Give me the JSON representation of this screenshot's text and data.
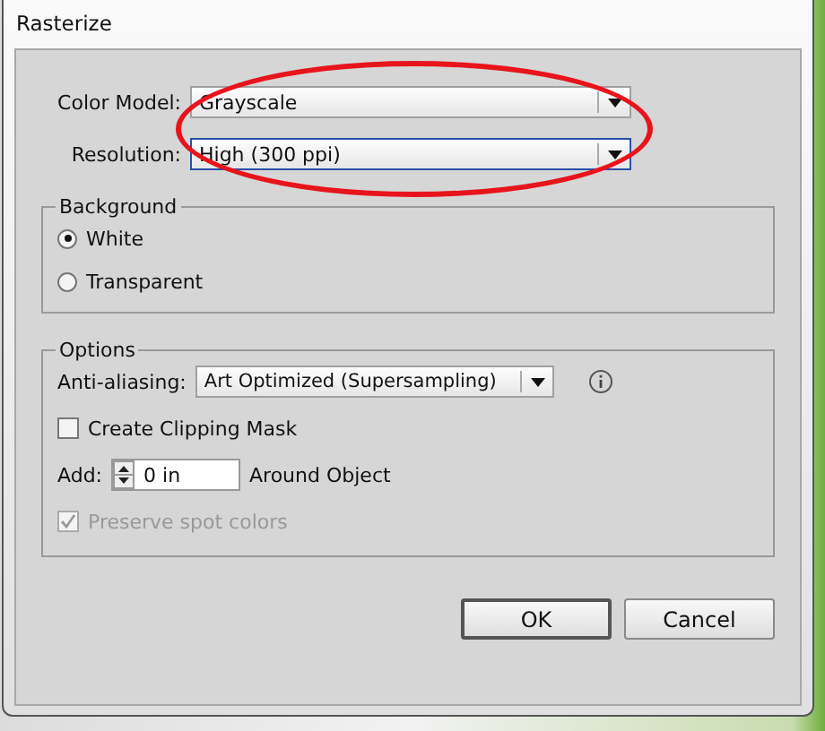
{
  "window": {
    "title": "Rasterize"
  },
  "annotation_ellipse": true,
  "fields": [
    {
      "label": "Color Model:",
      "value": "Grayscale",
      "focused": false
    },
    {
      "label": "Resolution:",
      "value": "High (300 ppi)",
      "focused": true
    }
  ],
  "background": {
    "title": "Background",
    "options": [
      {
        "label": "White",
        "selected": true
      },
      {
        "label": "Transparent",
        "selected": false
      }
    ]
  },
  "options": {
    "title": "Options",
    "anti_aliasing": {
      "label": "Anti-aliasing:",
      "value": "Art Optimized (Supersampling)"
    },
    "clipping_mask": {
      "label": "Create Clipping Mask",
      "checked": false,
      "disabled": false
    },
    "add": {
      "label": "Add:",
      "value": "0 in",
      "suffix": "Around Object"
    },
    "preserve_spot": {
      "label": "Preserve spot colors",
      "checked": true,
      "disabled": true
    }
  },
  "buttons": [
    {
      "label": "OK",
      "default": true
    },
    {
      "label": "Cancel",
      "default": false
    }
  ]
}
